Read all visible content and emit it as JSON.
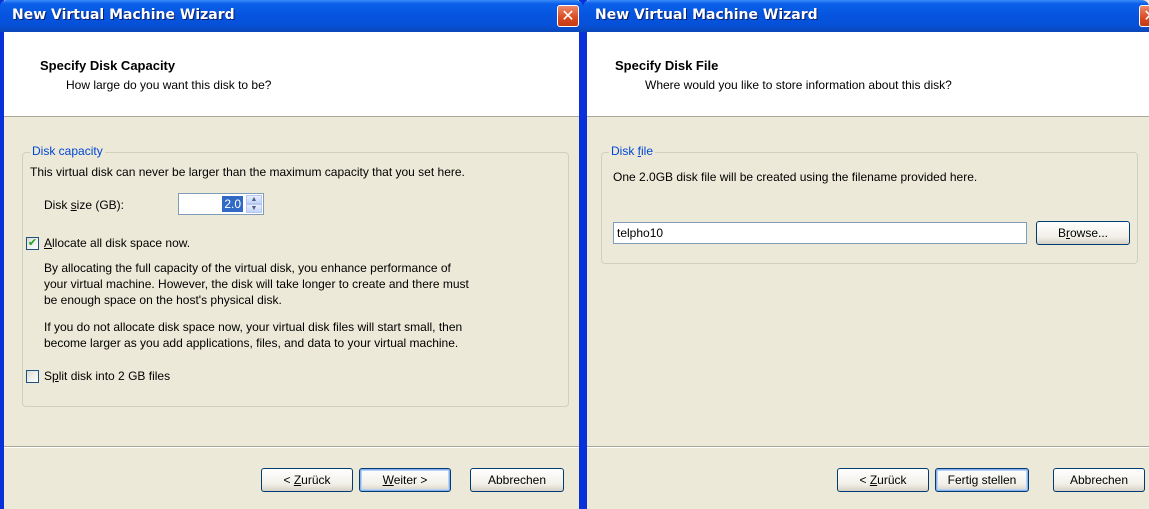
{
  "left": {
    "title": "New Virtual Machine Wizard",
    "close_glyph": "✕",
    "header_title": "Specify Disk Capacity",
    "header_sub": "How large do you want this disk to be?",
    "group_label": "Disk capacity",
    "group_desc": "This virtual disk can never be larger than the maximum capacity that you set here.",
    "disk_size_label_pre": "Disk ",
    "disk_size_label_u": "s",
    "disk_size_label_post": "ize (GB):",
    "disk_size_value": "2.0",
    "allocate_u": "A",
    "allocate_rest": "llocate all disk space now.",
    "allocate_checked": "✔",
    "allocate_desc_1": "By allocating the full capacity of the virtual disk, you enhance performance of",
    "allocate_desc_2": "your virtual machine.  However, the disk will take longer to create and there must",
    "allocate_desc_3": "be enough space on the host's physical disk.",
    "nonalloc_desc_1": "If you do not allocate disk space now, your virtual disk files will start small, then",
    "nonalloc_desc_2": "become larger as you add applications, files, and data to your virtual machine.",
    "split_pre": "S",
    "split_u": "p",
    "split_post": "lit disk into 2 GB files",
    "back_pre": "< ",
    "back_u": "Z",
    "back_post": "urück",
    "next_u": "W",
    "next_post": "eiter >",
    "cancel_label": "Abbrechen"
  },
  "right": {
    "title": "New Virtual Machine Wizard",
    "close_glyph": "✕",
    "header_title": "Specify Disk File",
    "header_sub": "Where would you like to store information about this disk?",
    "group_label_pre": "Disk ",
    "group_label_u": "f",
    "group_label_post": "ile",
    "group_desc": "One 2.0GB disk file will be created using the filename provided here.",
    "filename_value": "telpho10",
    "browse_pre": "B",
    "browse_u": "r",
    "browse_post": "owse...",
    "back_pre": "< ",
    "back_u": "Z",
    "back_post": "urück",
    "finish_label": "Fertig stellen",
    "cancel_label": "Abbrechen"
  },
  "colors": {
    "titlebar": "#0654df",
    "window_border": "#0831d9",
    "dialog_bg": "#ece9d8",
    "group_label": "#0046d5",
    "close_button": "#d9491f"
  }
}
